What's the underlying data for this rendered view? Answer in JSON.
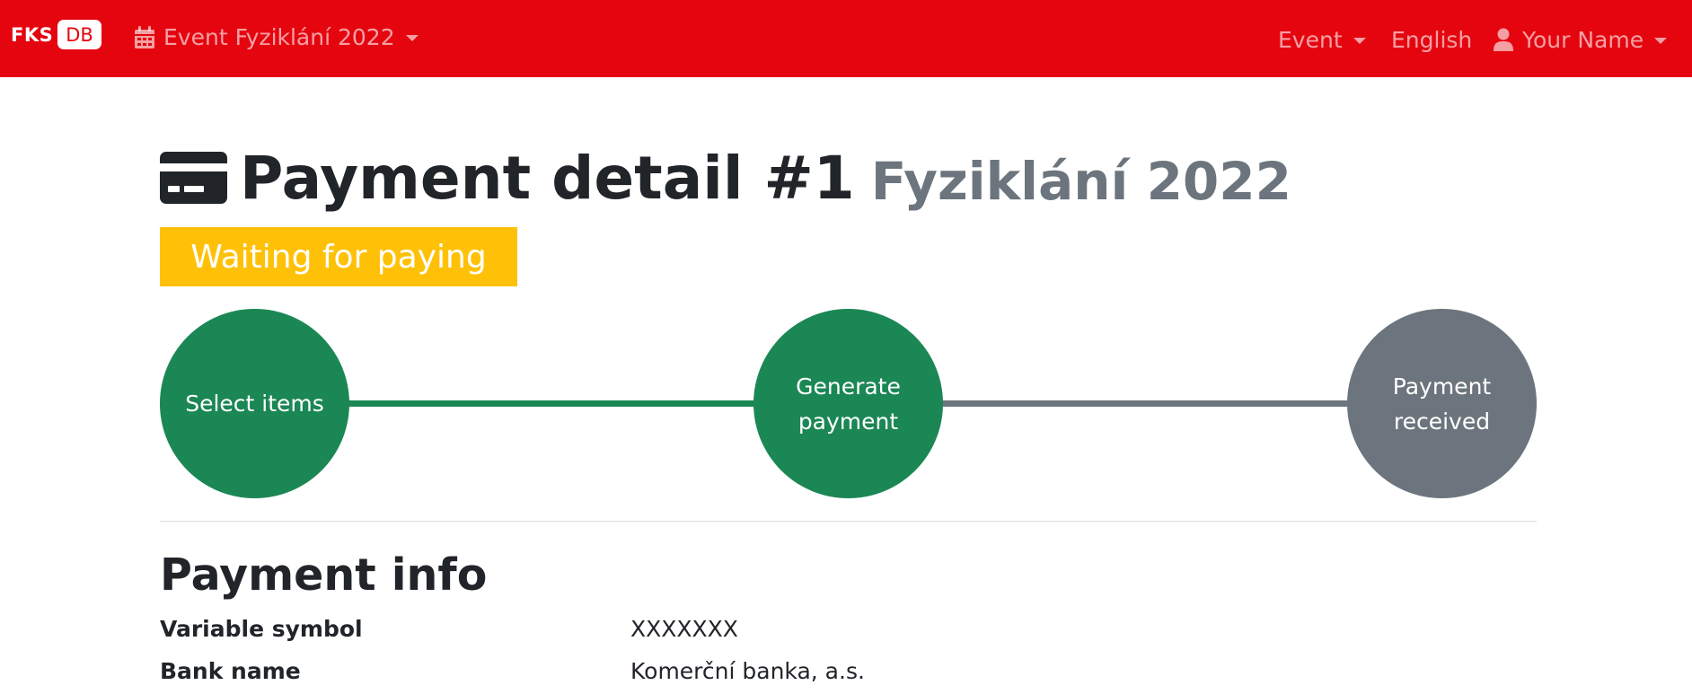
{
  "navbar": {
    "brand_fks": "FKS",
    "brand_db": "DB",
    "event_select_label": "Event Fyziklání 2022",
    "event_menu_label": "Event",
    "language_label": "English",
    "user_label": "Your Name"
  },
  "header": {
    "title": "Payment detail #1",
    "subtitle": "Fyziklání 2022",
    "status": "Waiting for paying"
  },
  "steps": [
    {
      "label": "Select items",
      "state": "done"
    },
    {
      "label": "Generate payment",
      "state": "done"
    },
    {
      "label": "Payment received",
      "state": "todo"
    }
  ],
  "payment_info": {
    "title": "Payment info",
    "rows": [
      {
        "label": "Variable symbol",
        "value": "XXXXXXX"
      },
      {
        "label": "Bank name",
        "value": "Komerční banka, a.s."
      }
    ]
  },
  "colors": {
    "navbar": "#e5050f",
    "status_badge": "#ffc107",
    "step_done": "#1b8754",
    "step_todo": "#6c757d"
  },
  "icons": {
    "event_select": "calendar-icon",
    "user": "user-icon",
    "title": "credit-card-icon"
  }
}
